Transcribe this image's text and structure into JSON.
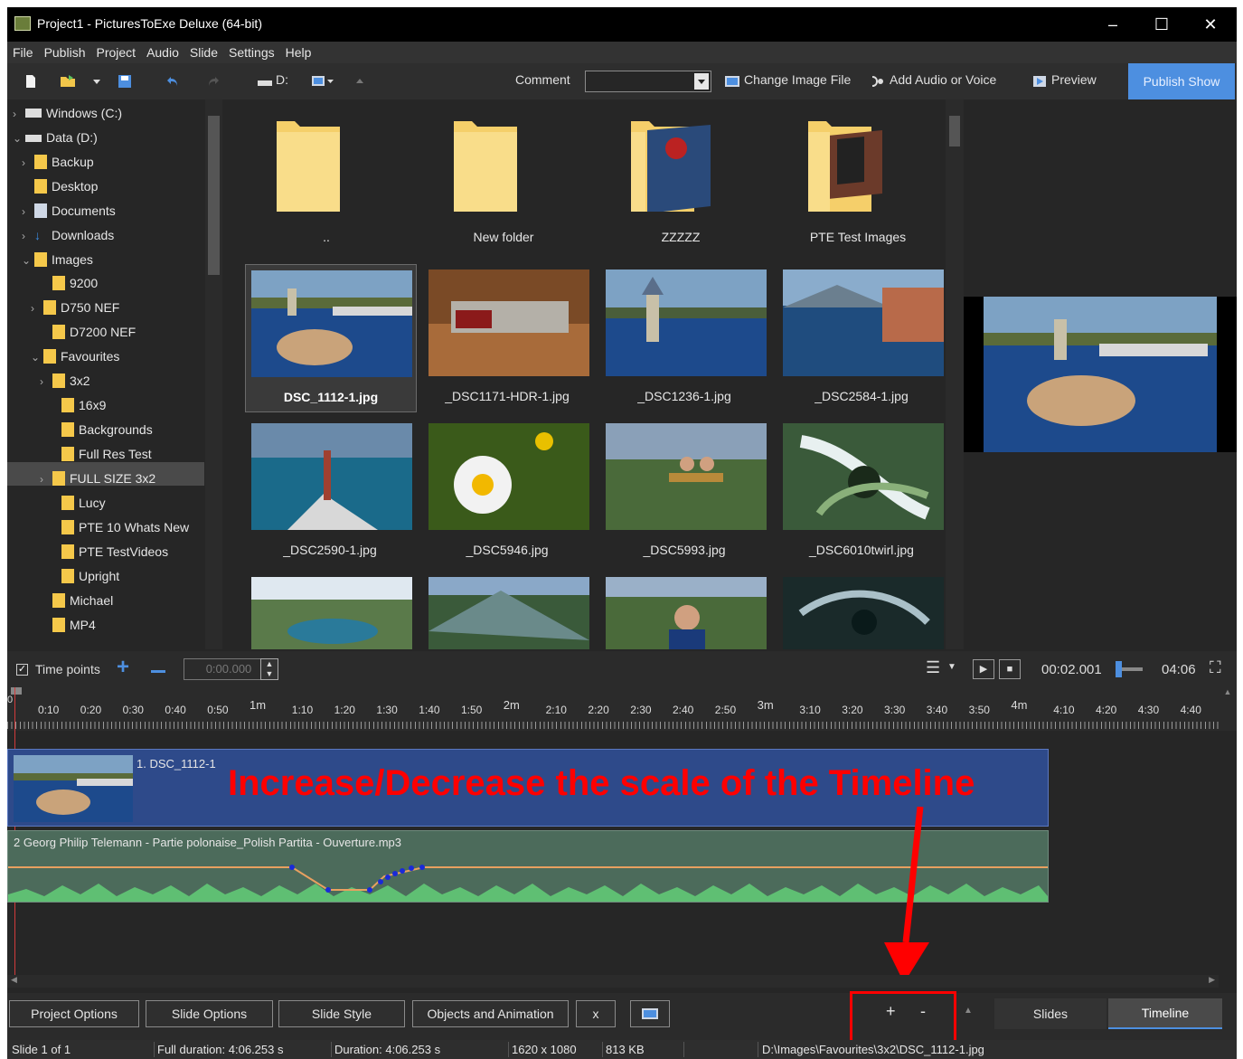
{
  "window": {
    "title": "Project1 - PicturesToExe Deluxe (64-bit)"
  },
  "menu": [
    "File",
    "Publish",
    "Project",
    "Audio",
    "Slide",
    "Settings",
    "Help"
  ],
  "toolbar": {
    "drive": "D:",
    "comment_label": "Comment",
    "change_image": "Change Image File",
    "add_audio": "Add Audio or Voice",
    "preview": "Preview",
    "publish": "Publish Show"
  },
  "tree": [
    {
      "label": "Windows (C:)"
    },
    {
      "label": "Data (D:)"
    },
    {
      "label": "Backup"
    },
    {
      "label": "Desktop"
    },
    {
      "label": "Documents"
    },
    {
      "label": "Downloads"
    },
    {
      "label": "Images"
    },
    {
      "label": "9200"
    },
    {
      "label": "D750 NEF"
    },
    {
      "label": "D7200 NEF"
    },
    {
      "label": "Favourites"
    },
    {
      "label": "3x2"
    },
    {
      "label": "16x9"
    },
    {
      "label": "Backgrounds"
    },
    {
      "label": "Full Res Test"
    },
    {
      "label": "FULL SIZE 3x2"
    },
    {
      "label": "Lucy"
    },
    {
      "label": "PTE 10 Whats New"
    },
    {
      "label": "PTE TestVideos"
    },
    {
      "label": "Upright"
    },
    {
      "label": "Michael"
    },
    {
      "label": "MP4"
    }
  ],
  "folders": [
    {
      "label": ".."
    },
    {
      "label": "New folder"
    },
    {
      "label": "ZZZZZ"
    },
    {
      "label": "PTE Test Images"
    }
  ],
  "files": [
    {
      "label": "DSC_1112-1.jpg"
    },
    {
      "label": "_DSC1171-HDR-1.jpg"
    },
    {
      "label": "_DSC1236-1.jpg"
    },
    {
      "label": "_DSC2584-1.jpg"
    },
    {
      "label": "_DSC2590-1.jpg"
    },
    {
      "label": "_DSC5946.jpg"
    },
    {
      "label": "_DSC5993.jpg"
    },
    {
      "label": "_DSC6010twirl.jpg"
    }
  ],
  "timeline": {
    "time_points_label": "Time points",
    "time_input": "0:00.000",
    "current_time": "00:02.001",
    "total_time": "04:06",
    "ticks": [
      "0:10",
      "0:20",
      "0:30",
      "0:40",
      "0:50",
      "1m",
      "1:10",
      "1:20",
      "1:30",
      "1:40",
      "1:50",
      "2m",
      "2:10",
      "2:20",
      "2:30",
      "2:40",
      "2:50",
      "3m",
      "3:10",
      "3:20",
      "3:30",
      "3:40",
      "3:50",
      "4m",
      "4:10",
      "4:20",
      "4:30",
      "4:40"
    ],
    "slide_label": "1. DSC_1112-1",
    "audio_label": "2 Georg Philip Telemann - Partie polonaise_Polish Partita - Ouverture.mp3",
    "annotation": "Increase/Decrease the scale of the Timeline",
    "annotation_color": "#ff0000"
  },
  "bottom": {
    "project_options": "Project Options",
    "slide_options": "Slide Options",
    "slide_style": "Slide Style",
    "objects": "Objects and Animation",
    "x": "x",
    "plus": "+",
    "minus": "-",
    "tab_slides": "Slides",
    "tab_timeline": "Timeline"
  },
  "status": {
    "slide": "Slide 1 of 1",
    "full_duration": "Full duration: 4:06.253 s",
    "duration": "Duration: 4:06.253 s",
    "resolution": "1620 x 1080",
    "size": "813 KB",
    "path": "D:\\Images\\Favourites\\3x2\\DSC_1112-1.jpg"
  },
  "colors": {
    "accent": "#4d8fe0",
    "slide_track": "#2e4a8a",
    "audio_track": "#4c6b5b"
  }
}
